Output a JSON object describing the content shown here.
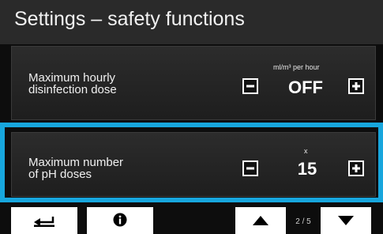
{
  "header": {
    "title": "Settings – safety functions"
  },
  "settings": [
    {
      "label_line1": "Maximum hourly",
      "label_line2": "disinfection dose",
      "unit": "ml/m³ per hour",
      "value": "OFF"
    },
    {
      "label_line1": "Maximum number",
      "label_line2": "of pH doses",
      "unit": "x",
      "value": "15"
    }
  ],
  "footer": {
    "page_indicator": "2 / 5"
  },
  "icons": {
    "minus": "minus-icon",
    "plus": "plus-icon",
    "back": "return-arrow-icon",
    "info": "info-icon",
    "up": "triangle-up-icon",
    "down": "triangle-down-icon"
  },
  "colors": {
    "selection": "#17a6dd",
    "background": "#0d0d0d",
    "title_bar": "#2a2a2a"
  }
}
